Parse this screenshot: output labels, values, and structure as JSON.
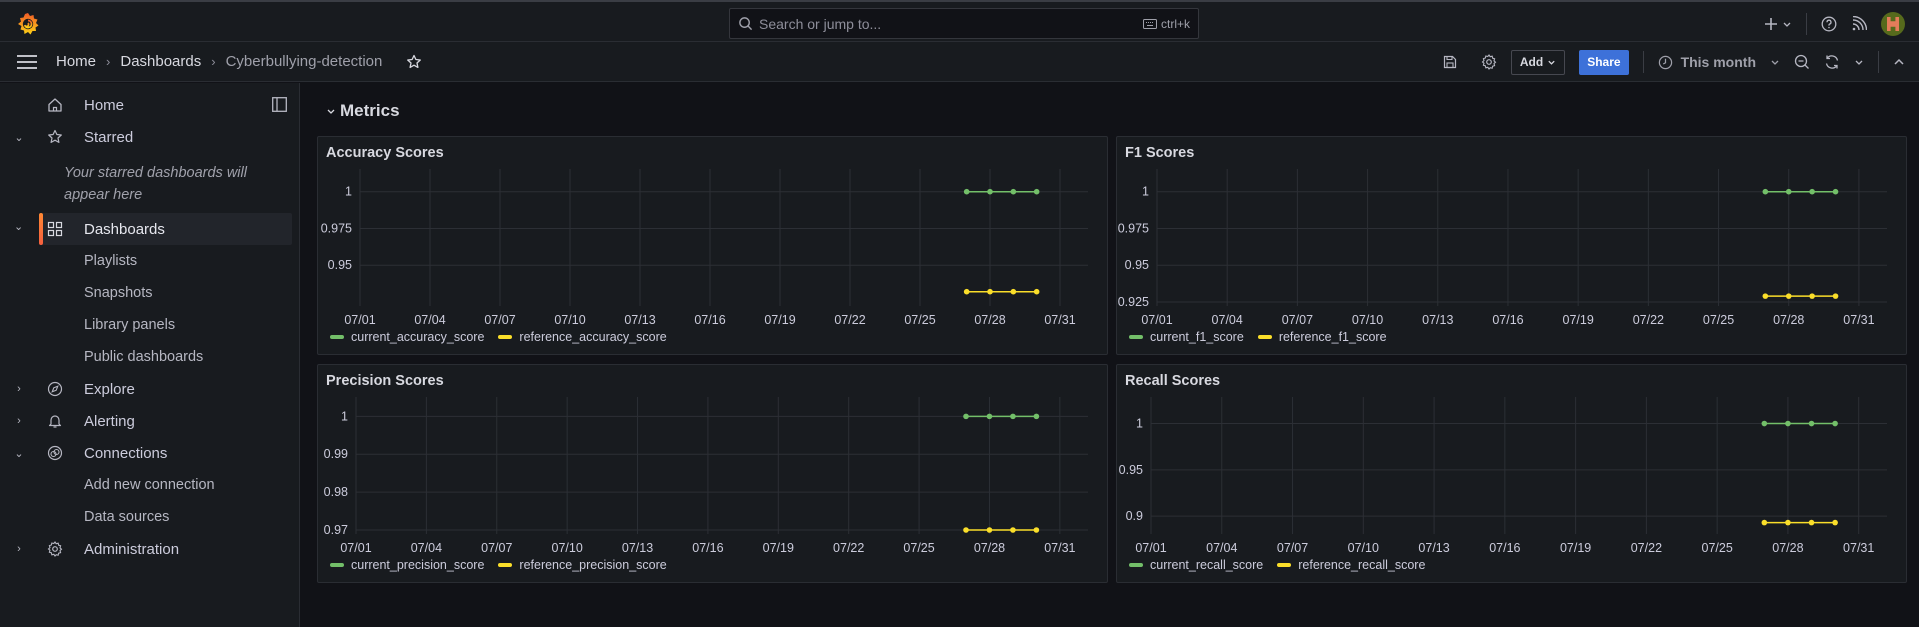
{
  "topbar": {
    "search_placeholder": "Search or jump to...",
    "search_shortcut": "ctrl+k"
  },
  "navbar": {
    "breadcrumbs": [
      "Home",
      "Dashboards",
      "Cyberbullying-detection"
    ],
    "add_label": "Add",
    "share_label": "Share",
    "time_range": "This month"
  },
  "sidebar": {
    "items": [
      {
        "label": "Home",
        "icon": "home-icon"
      },
      {
        "label": "Starred",
        "icon": "star-icon",
        "expanded": true
      },
      {
        "label": "Dashboards",
        "icon": "apps-icon",
        "expanded": true,
        "active": true
      },
      {
        "label": "Playlists"
      },
      {
        "label": "Snapshots"
      },
      {
        "label": "Library panels"
      },
      {
        "label": "Public dashboards"
      },
      {
        "label": "Explore",
        "icon": "compass-icon",
        "expanded": false
      },
      {
        "label": "Alerting",
        "icon": "bell-icon",
        "expanded": false
      },
      {
        "label": "Connections",
        "icon": "connections-icon",
        "expanded": true
      },
      {
        "label": "Add new connection"
      },
      {
        "label": "Data sources"
      },
      {
        "label": "Administration",
        "icon": "gear-icon",
        "expanded": false
      }
    ],
    "starred_empty": "Your starred dashboards will appear here"
  },
  "dashboard": {
    "row_title": "Metrics"
  },
  "colors": {
    "current": "#73bf69",
    "reference": "#fade2a",
    "accent": "#f55f3e",
    "share": "#3d71d9"
  },
  "chart_data": [
    {
      "type": "line",
      "title": "Accuracy Scores",
      "x_ticks": [
        "07/01",
        "07/04",
        "07/07",
        "07/10",
        "07/13",
        "07/16",
        "07/19",
        "07/22",
        "07/25",
        "07/28",
        "07/31"
      ],
      "x": [
        "07/27",
        "07/28",
        "07/29",
        "07/30"
      ],
      "y_ticks": [
        "1",
        "0.975",
        "0.95"
      ],
      "ylim": [
        0.925,
        1.01
      ],
      "series": [
        {
          "name": "current_accuracy_score",
          "values": [
            1,
            1,
            1,
            1
          ]
        },
        {
          "name": "reference_accuracy_score",
          "values": [
            0.932,
            0.932,
            0.932,
            0.932
          ]
        }
      ],
      "legend": "bottom"
    },
    {
      "type": "line",
      "title": "F1 Scores",
      "x_ticks": [
        "07/01",
        "07/04",
        "07/07",
        "07/10",
        "07/13",
        "07/16",
        "07/19",
        "07/22",
        "07/25",
        "07/28",
        "07/31"
      ],
      "x": [
        "07/27",
        "07/28",
        "07/29",
        "07/30"
      ],
      "y_ticks": [
        "1",
        "0.975",
        "0.95",
        "0.925"
      ],
      "ylim": [
        0.925,
        1.01
      ],
      "series": [
        {
          "name": "current_f1_score",
          "values": [
            1,
            1,
            1,
            1
          ]
        },
        {
          "name": "reference_f1_score",
          "values": [
            0.929,
            0.929,
            0.929,
            0.929
          ]
        }
      ],
      "legend": "bottom"
    },
    {
      "type": "line",
      "title": "Precision Scores",
      "x_ticks": [
        "07/01",
        "07/04",
        "07/07",
        "07/10",
        "07/13",
        "07/16",
        "07/19",
        "07/22",
        "07/25",
        "07/28",
        "07/31"
      ],
      "x": [
        "07/27",
        "07/28",
        "07/29",
        "07/30"
      ],
      "y_ticks": [
        "1",
        "0.99",
        "0.98",
        "0.97"
      ],
      "ylim": [
        0.97,
        1.003
      ],
      "series": [
        {
          "name": "current_precision_score",
          "values": [
            1,
            1,
            1,
            1
          ]
        },
        {
          "name": "reference_precision_score",
          "values": [
            0.97,
            0.97,
            0.97,
            0.97
          ]
        }
      ],
      "legend": "bottom"
    },
    {
      "type": "line",
      "title": "Recall Scores",
      "x_ticks": [
        "07/01",
        "07/04",
        "07/07",
        "07/10",
        "07/13",
        "07/16",
        "07/19",
        "07/22",
        "07/25",
        "07/28",
        "07/31"
      ],
      "x": [
        "07/27",
        "07/28",
        "07/29",
        "07/30"
      ],
      "y_ticks": [
        "1",
        "0.95",
        "0.9"
      ],
      "ylim": [
        0.885,
        1.02
      ],
      "series": [
        {
          "name": "current_recall_score",
          "values": [
            1,
            1,
            1,
            1
          ]
        },
        {
          "name": "reference_recall_score",
          "values": [
            0.893,
            0.893,
            0.893,
            0.893
          ]
        }
      ],
      "legend": "bottom"
    }
  ]
}
